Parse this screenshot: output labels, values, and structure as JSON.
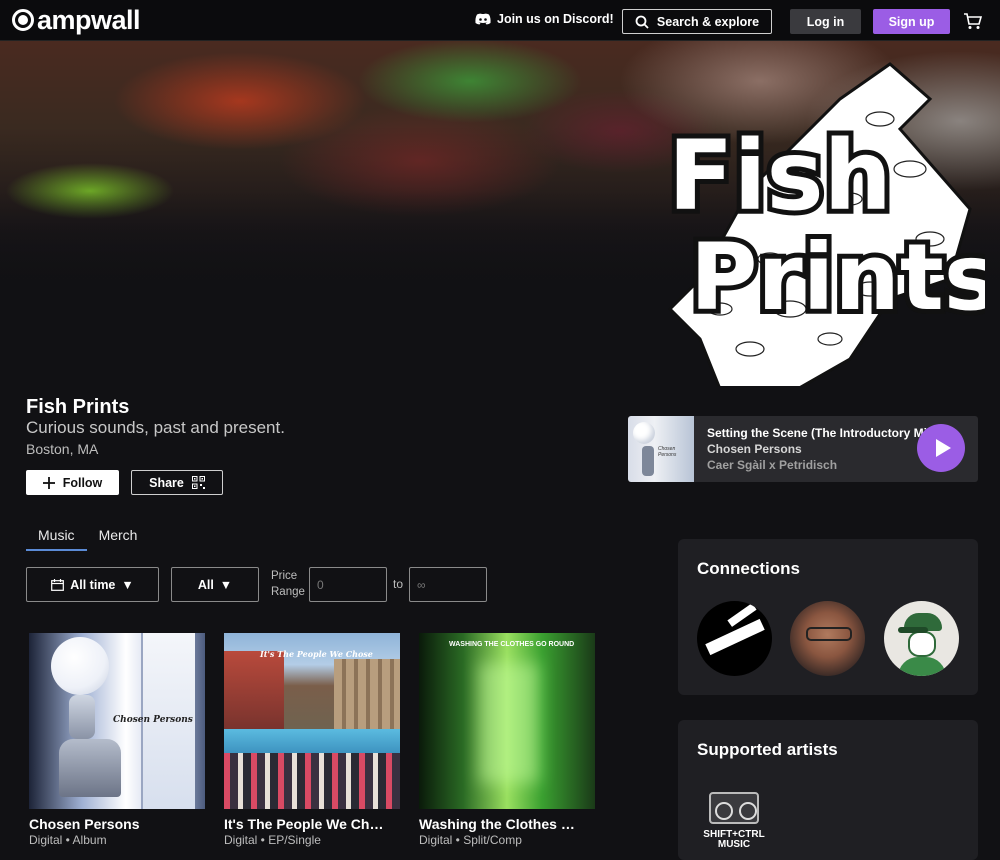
{
  "nav": {
    "logo_text": "ampwall",
    "discord_label": "Join us on Discord!",
    "search_label": "Search & explore",
    "login_label": "Log in",
    "signup_label": "Sign up",
    "accent_color": "#9b5de5"
  },
  "banner": {
    "logo_line1": "Fish",
    "logo_line2": "Prints"
  },
  "artist": {
    "name": "Fish Prints",
    "tagline": "Curious sounds, past and present.",
    "location": "Boston, MA",
    "follow_label": "Follow",
    "share_label": "Share"
  },
  "player": {
    "track_title": "Setting the Scene (The Introductory Mix)",
    "album": "Chosen Persons",
    "artist": "Caer Sgàil x Petridisch",
    "art_text": "Chosen Persons"
  },
  "tabs": [
    {
      "label": "Music",
      "active": true
    },
    {
      "label": "Merch",
      "active": false
    }
  ],
  "filters": {
    "time_label": "All time",
    "type_label": "All",
    "price_label_1": "Price",
    "price_label_2": "Range",
    "price_min_placeholder": "0",
    "price_to": "to",
    "price_max_placeholder": "∞"
  },
  "releases": [
    {
      "title": "Chosen Persons",
      "meta": "Digital • Album",
      "art_text": "Chosen Persons"
    },
    {
      "title": "It's The People We Cho…",
      "meta": "Digital • EP/Single",
      "art_text": "It's The People We Chose"
    },
    {
      "title": "Washing the Clothes Go…",
      "meta": "Digital • Split/Comp",
      "art_text": "WASHING THE CLOTHES GO ROUND"
    }
  ],
  "connections": {
    "title": "Connections"
  },
  "supported": {
    "title": "Supported artists",
    "artist_text": "SHIFT+CTRL MUSIC"
  }
}
